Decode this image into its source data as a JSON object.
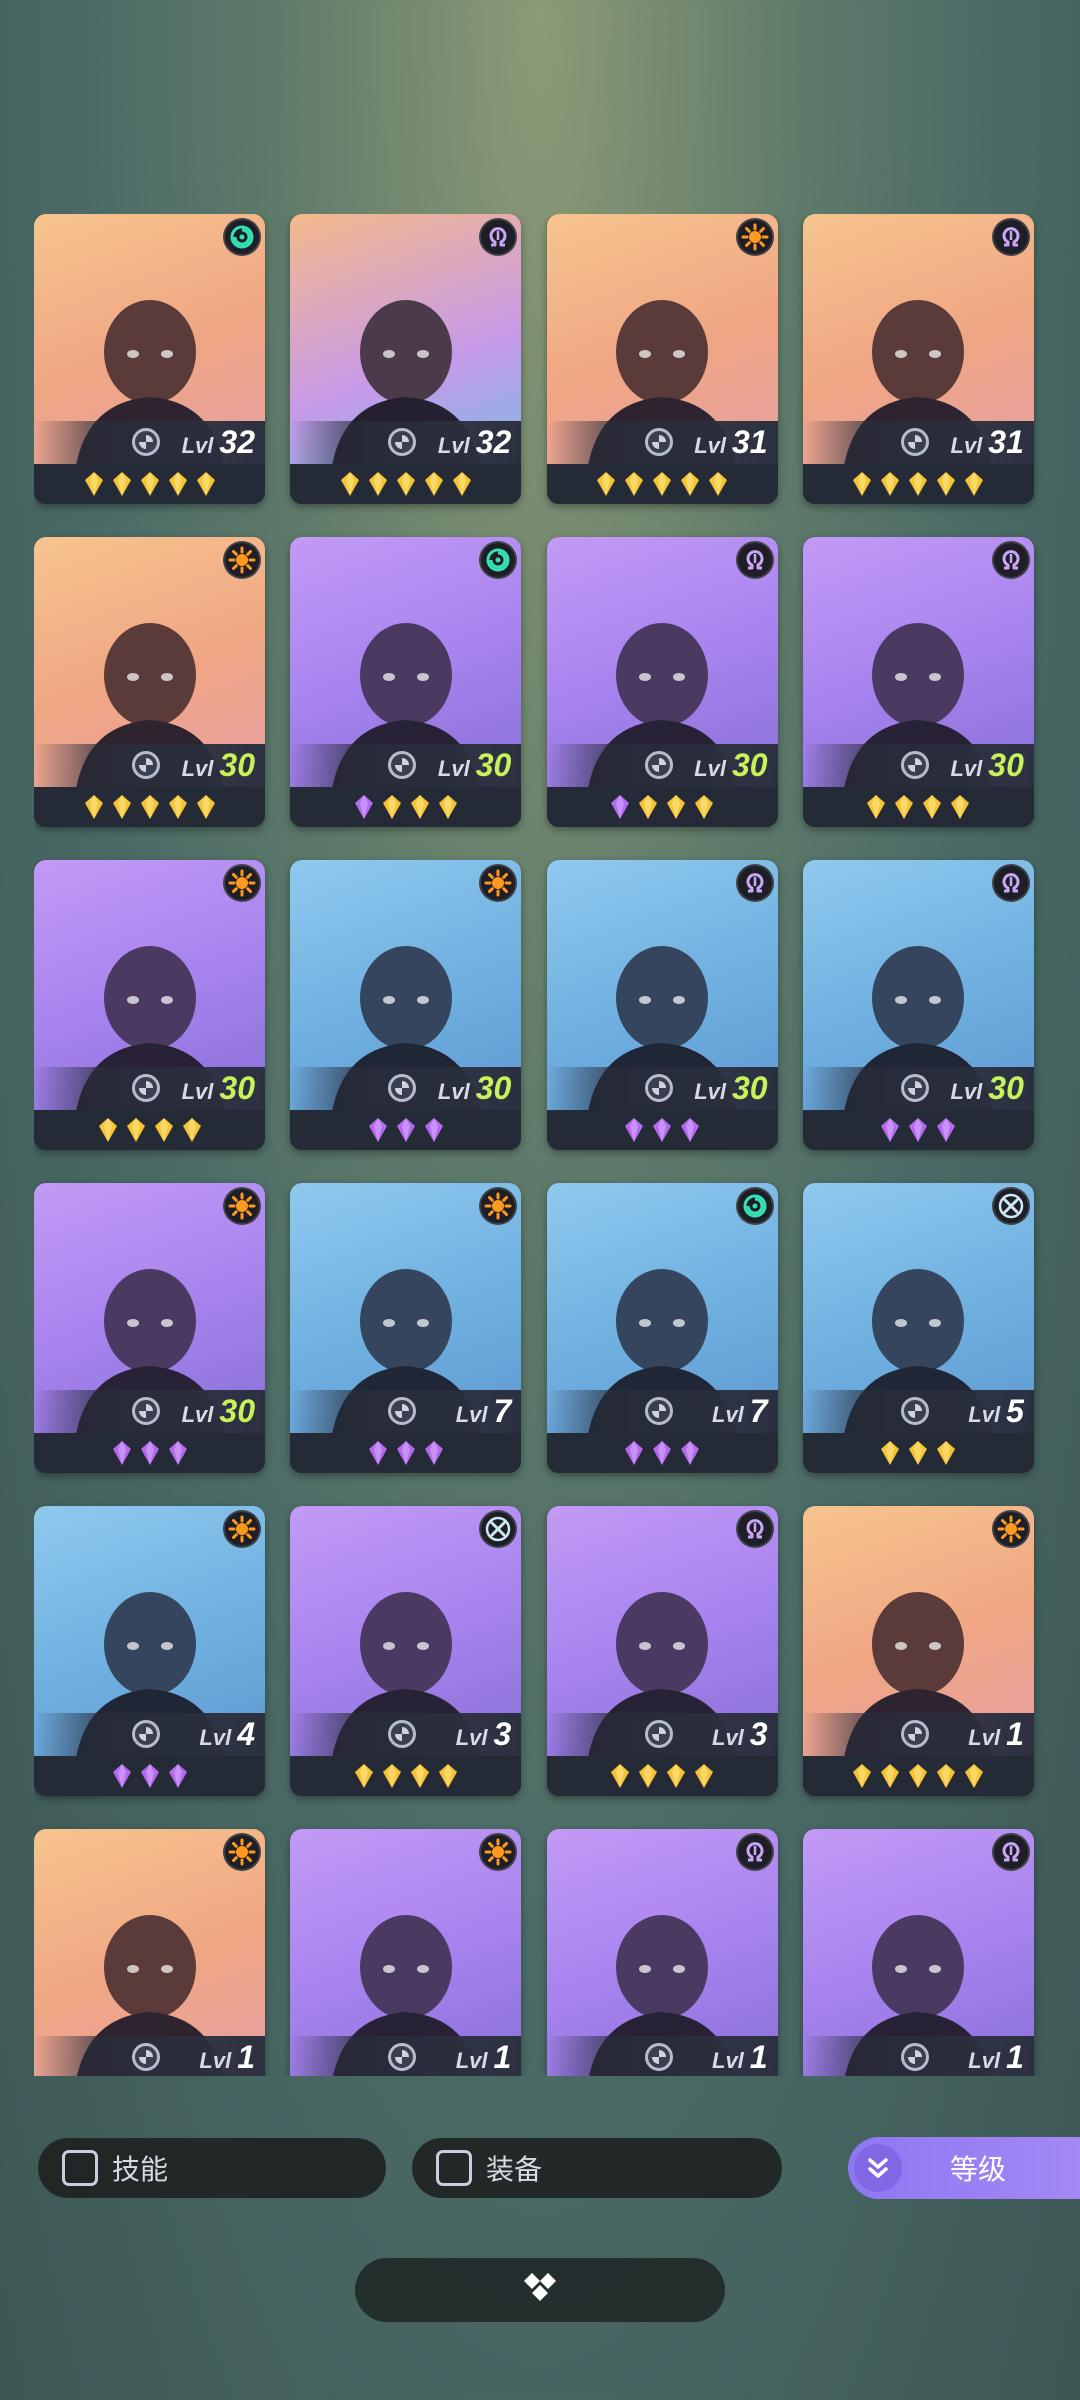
{
  "colors": {
    "lvl_green": "#c8f25a",
    "star_gold": "#f7c531",
    "gem_purple": "#b36af0",
    "accent_purple": "#9a82f4"
  },
  "heroes": [
    {
      "level_label": "Lvl",
      "level": "32",
      "level_color": "white",
      "bg": "orange",
      "class_icon": "swirl-icon",
      "rank": "gold",
      "stars": 5
    },
    {
      "level_label": "Lvl",
      "level": "32",
      "level_color": "white",
      "bg": "mixed",
      "class_icon": "omega-icon",
      "rank": "gold",
      "stars": 5
    },
    {
      "level_label": "Lvl",
      "level": "31",
      "level_color": "white",
      "bg": "orange",
      "class_icon": "sun-icon",
      "rank": "gold",
      "stars": 5
    },
    {
      "level_label": "Lvl",
      "level": "31",
      "level_color": "white",
      "bg": "orange",
      "class_icon": "omega-icon",
      "rank": "gold",
      "stars": 5
    },
    {
      "level_label": "Lvl",
      "level": "30",
      "level_color": "green",
      "bg": "orange",
      "class_icon": "sun-icon",
      "rank": "gold",
      "stars": 5
    },
    {
      "level_label": "Lvl",
      "level": "30",
      "level_color": "green",
      "bg": "purple",
      "class_icon": "swirl-icon",
      "rank": "mixed",
      "stars": 4
    },
    {
      "level_label": "Lvl",
      "level": "30",
      "level_color": "green",
      "bg": "purple",
      "class_icon": "omega-icon",
      "rank": "mixed",
      "stars": 4
    },
    {
      "level_label": "Lvl",
      "level": "30",
      "level_color": "green",
      "bg": "purple",
      "class_icon": "omega-icon",
      "rank": "gold",
      "stars": 4
    },
    {
      "level_label": "Lvl",
      "level": "30",
      "level_color": "green",
      "bg": "purple",
      "class_icon": "sun-icon",
      "rank": "gold",
      "stars": 4
    },
    {
      "level_label": "Lvl",
      "level": "30",
      "level_color": "green",
      "bg": "blue",
      "class_icon": "sun-icon",
      "rank": "purple",
      "stars": 3
    },
    {
      "level_label": "Lvl",
      "level": "30",
      "level_color": "green",
      "bg": "blue",
      "class_icon": "omega-icon",
      "rank": "purple",
      "stars": 3
    },
    {
      "level_label": "Lvl",
      "level": "30",
      "level_color": "green",
      "bg": "blue",
      "class_icon": "omega-icon",
      "rank": "purple",
      "stars": 3
    },
    {
      "level_label": "Lvl",
      "level": "30",
      "level_color": "green",
      "bg": "purple",
      "class_icon": "sun-icon",
      "rank": "purple",
      "stars": 3
    },
    {
      "level_label": "Lvl",
      "level": "7",
      "level_color": "white",
      "bg": "blue",
      "class_icon": "sun-icon",
      "rank": "purple",
      "stars": 3
    },
    {
      "level_label": "Lvl",
      "level": "7",
      "level_color": "white",
      "bg": "blue",
      "class_icon": "swirl-icon",
      "rank": "purple",
      "stars": 3
    },
    {
      "level_label": "Lvl",
      "level": "5",
      "level_color": "white",
      "bg": "blue",
      "class_icon": "cross-icon",
      "rank": "gold",
      "stars": 3
    },
    {
      "level_label": "Lvl",
      "level": "4",
      "level_color": "white",
      "bg": "blue",
      "class_icon": "sun-icon",
      "rank": "purple",
      "stars": 3
    },
    {
      "level_label": "Lvl",
      "level": "3",
      "level_color": "white",
      "bg": "purple",
      "class_icon": "cross-icon",
      "rank": "gold",
      "stars": 4
    },
    {
      "level_label": "Lvl",
      "level": "3",
      "level_color": "white",
      "bg": "purple",
      "class_icon": "omega-icon",
      "rank": "gold",
      "stars": 4
    },
    {
      "level_label": "Lvl",
      "level": "1",
      "level_color": "white",
      "bg": "orange",
      "class_icon": "sun-icon",
      "rank": "gold",
      "stars": 5
    },
    {
      "level_label": "Lvl",
      "level": "1",
      "level_color": "white",
      "bg": "orange",
      "class_icon": "sun-icon",
      "rank": "gold",
      "stars": 0
    },
    {
      "level_label": "Lvl",
      "level": "1",
      "level_color": "white",
      "bg": "purple",
      "class_icon": "sun-icon",
      "rank": "gold",
      "stars": 0
    },
    {
      "level_label": "Lvl",
      "level": "1",
      "level_color": "white",
      "bg": "purple",
      "class_icon": "omega-icon",
      "rank": "gold",
      "stars": 0
    },
    {
      "level_label": "Lvl",
      "level": "1",
      "level_color": "white",
      "bg": "purple",
      "class_icon": "omega-icon",
      "rank": "gold",
      "stars": 0
    }
  ],
  "filters": {
    "skill_label": "技能",
    "equipment_label": "装备",
    "sort_label": "等级"
  }
}
